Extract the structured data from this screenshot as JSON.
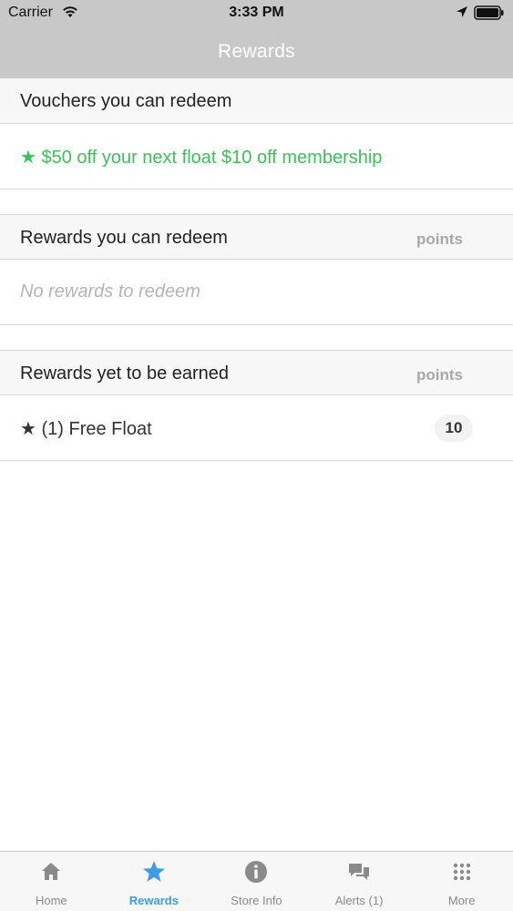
{
  "status": {
    "carrier": "Carrier",
    "time": "3:33 PM"
  },
  "nav": {
    "title": "Rewards"
  },
  "vouchers": {
    "header": "Vouchers you can redeem",
    "items": [
      {
        "label": "★ $50 off your next float $10 off membership"
      }
    ]
  },
  "rewards_redeem": {
    "header": "Rewards you can redeem",
    "points_label": "points",
    "empty_text": "No rewards to redeem"
  },
  "rewards_earned": {
    "header": "Rewards yet to be earned",
    "points_label": "points",
    "items": [
      {
        "label": "★ (1) Free Float",
        "points": "10"
      }
    ]
  },
  "tabs": [
    {
      "label": "Home",
      "icon": "home-icon"
    },
    {
      "label": "Rewards",
      "icon": "star-icon",
      "active": true
    },
    {
      "label": "Store Info",
      "icon": "info-icon"
    },
    {
      "label": "Alerts (1)",
      "icon": "chat-bubbles-icon"
    },
    {
      "label": "More",
      "icon": "grid-dots-icon"
    }
  ],
  "colors": {
    "accent": "#3d9be9",
    "voucher_green": "#3cc15a",
    "nav_bg": "#c8c8c8"
  }
}
